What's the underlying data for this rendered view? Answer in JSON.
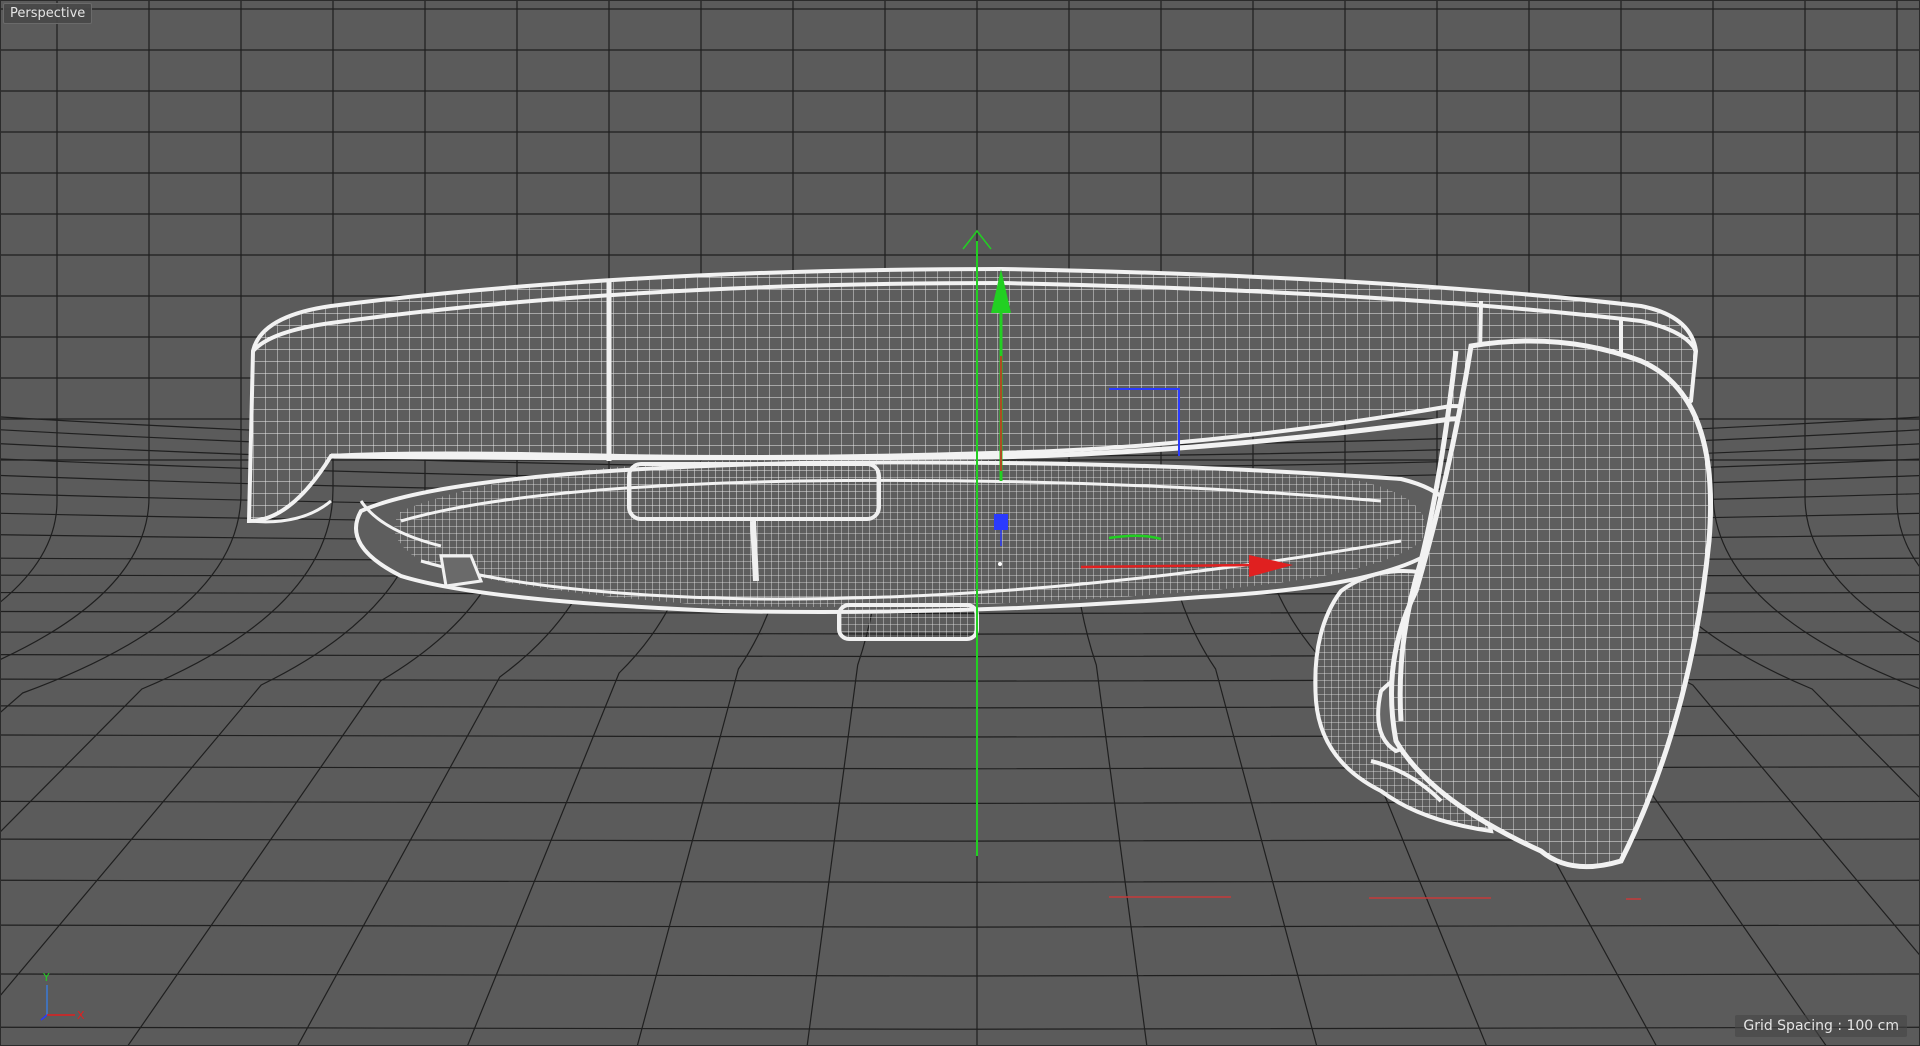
{
  "viewport": {
    "camera_label": "Perspective",
    "grid_spacing_label": "Grid Spacing : 100 cm"
  },
  "axis_indicator": {
    "y_label": "Y",
    "x_label": "X"
  },
  "colors": {
    "background": "#5b5b5b",
    "grid": "#1f1f1f",
    "wire": "#f0f0f0",
    "axis_x": "#e02020",
    "axis_y": "#22d022",
    "axis_z": "#2a3aff"
  }
}
